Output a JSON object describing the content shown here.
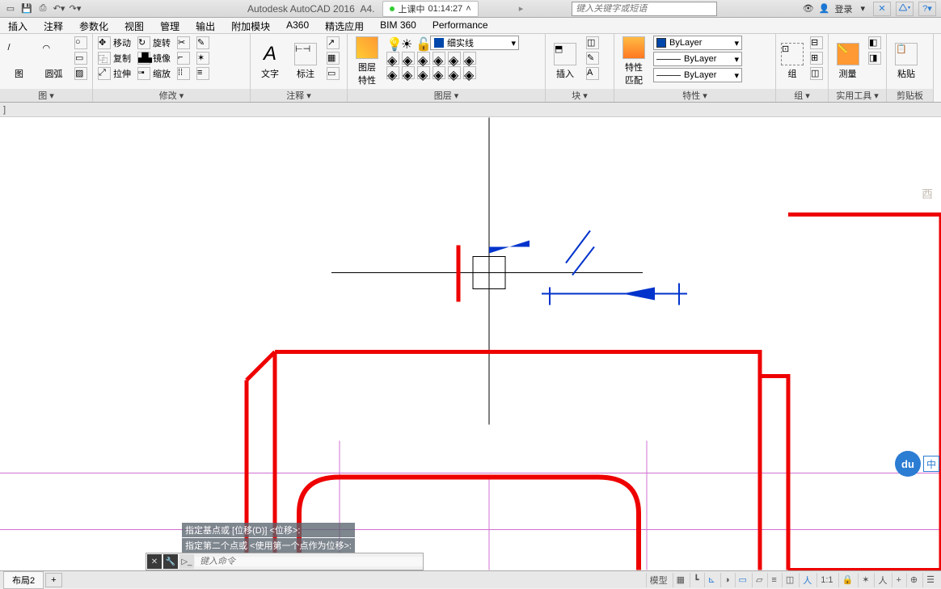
{
  "title": {
    "app": "Autodesk AutoCAD 2016",
    "doc": "A4.",
    "lesson_label": "上课中",
    "lesson_time": "01:14:27",
    "search_placeholder": "键入关键字或短语",
    "login": "登录"
  },
  "menu": [
    "插入",
    "注释",
    "参数化",
    "视图",
    "管理",
    "输出",
    "附加模块",
    "A360",
    "精选应用",
    "BIM 360",
    "Performance"
  ],
  "ribbon": {
    "panels": {
      "draw": {
        "title": "图 ▾",
        "arc": "圆弧"
      },
      "modify": {
        "title": "修改 ▾",
        "move": "移动",
        "copy": "复制",
        "stretch": "拉伸",
        "rotate": "旋转",
        "mirror": "镜像",
        "scale": "缩放"
      },
      "annot": {
        "title": "注释 ▾",
        "text": "文字",
        "dim": "标注"
      },
      "layers": {
        "title": "图层 ▾",
        "big": "图层\n特性",
        "current": "细实线"
      },
      "block": {
        "title": "块 ▾",
        "insert": "插入"
      },
      "props": {
        "title": "特性 ▾",
        "big": "特性\n匹配",
        "bylayer": "ByLayer"
      },
      "groups": {
        "title": "组 ▾",
        "big": "组"
      },
      "util": {
        "title": "实用工具 ▾",
        "big": "测量"
      },
      "clip": {
        "title": "剪贴板",
        "big": "粘贴"
      }
    }
  },
  "tagrow": "]",
  "command_history": [
    "指定基点或 [位移(D)] <位移>:",
    "指定第二个点或 <使用第一个点作为位移>:"
  ],
  "command_input": "键入命令",
  "status": {
    "layout": "布局2",
    "model": "模型",
    "scale": "1:1"
  },
  "baidu": {
    "logo": "du",
    "ch": "中"
  },
  "faded": "酉"
}
